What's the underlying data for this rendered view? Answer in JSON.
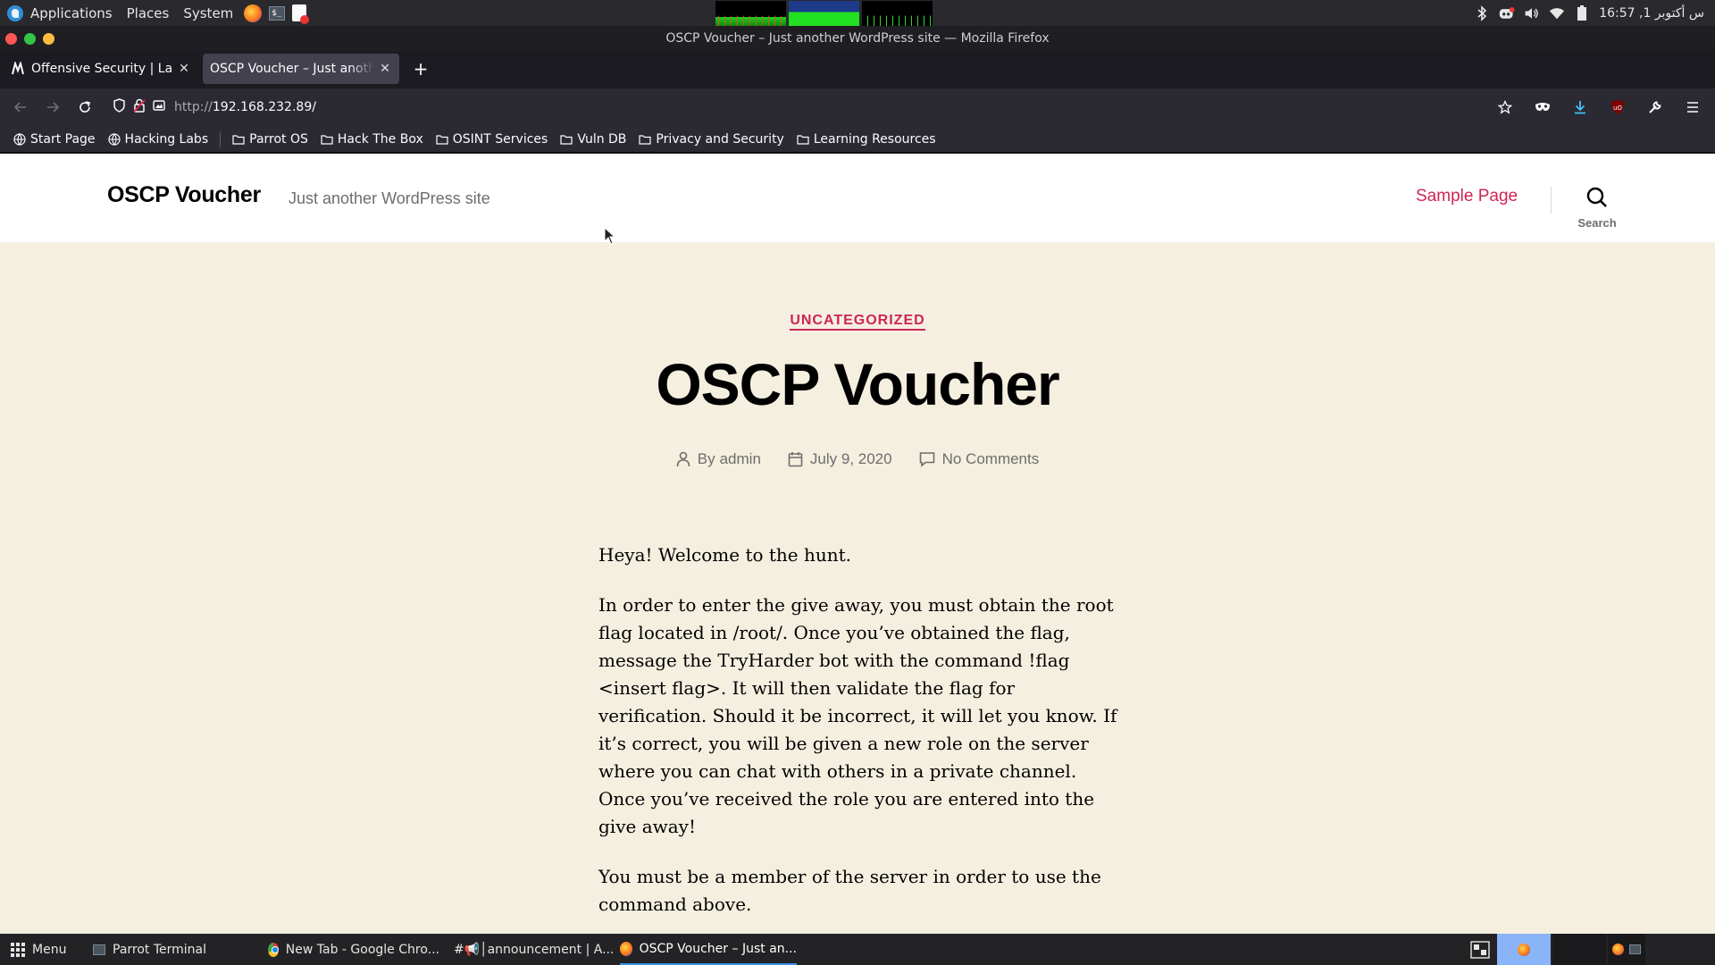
{
  "system_panel": {
    "menus": [
      "Applications",
      "Places",
      "System"
    ],
    "clock": "16:57 ,1 س أكتوبر"
  },
  "window": {
    "title": "OSCP Voucher – Just another WordPress site — Mozilla Firefox"
  },
  "tabs": [
    {
      "label": "Offensive Security | Labs |",
      "active": false
    },
    {
      "label": "OSCP Voucher – Just another WordPress site",
      "active": true
    }
  ],
  "navbar": {
    "url_scheme": "http://",
    "url_host": "192.168.232.89/"
  },
  "bookmarks": [
    {
      "label": "Start Page",
      "icon": "globe-icon"
    },
    {
      "label": "Hacking Labs",
      "icon": "globe-icon"
    },
    {
      "label": "Parrot OS",
      "icon": "folder-icon"
    },
    {
      "label": "Hack The Box",
      "icon": "folder-icon"
    },
    {
      "label": "OSINT Services",
      "icon": "folder-icon"
    },
    {
      "label": "Vuln DB",
      "icon": "folder-icon"
    },
    {
      "label": "Privacy and Security",
      "icon": "folder-icon"
    },
    {
      "label": "Learning Resources",
      "icon": "folder-icon"
    }
  ],
  "site": {
    "title": "OSCP Voucher",
    "description": "Just another WordPress site",
    "nav_link": "Sample Page",
    "search_label": "Search",
    "accent_color": "#cd2653",
    "background_color": "#f5efe0"
  },
  "post": {
    "category": "UNCATEGORIZED",
    "title": "OSCP Voucher",
    "author_prefix": "By",
    "author": "admin",
    "date": "July 9, 2020",
    "comments": "No Comments",
    "paragraphs": [
      "Heya! Welcome to the hunt.",
      "In order to enter the give away, you must obtain the root flag located in /root/. Once you’ve obtained the flag, message the TryHarder bot with the command !flag <insert flag>. It will then validate the flag for verification. Should it be incorrect, it will let you know. If it’s correct, you will be given a new role on the server where you can chat with others in a private channel. Once you’ve received the role you are entered into the give away!",
      "You must be a member of the server in order to use the command above."
    ]
  },
  "taskbar": {
    "menu_label": "Menu",
    "items": [
      {
        "label": "Parrot Terminal",
        "icon": "terminal-icon"
      },
      {
        "label": "New Tab - Google Chro...",
        "icon": "chrome-icon"
      },
      {
        "label": "#📢│announcement | A...",
        "icon": "discord-icon"
      },
      {
        "label": "OSCP Voucher – Just an...",
        "icon": "firefox-icon",
        "active": true
      }
    ]
  }
}
